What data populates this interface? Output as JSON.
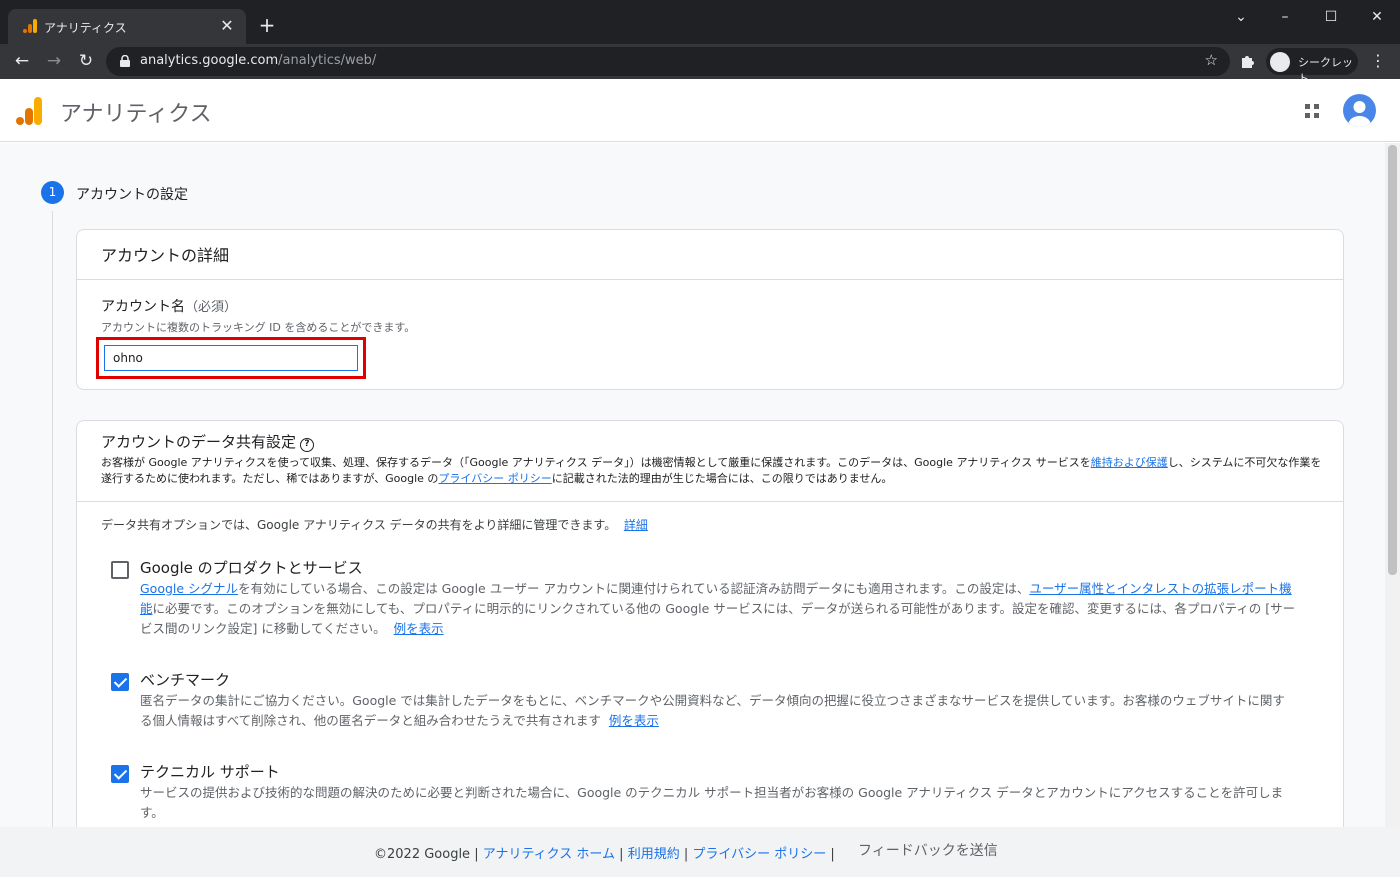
{
  "browser": {
    "tab_title": "アナリティクス",
    "url_host": "analytics.google.com",
    "url_path": "/analytics/web/",
    "incognito_label": "シークレット"
  },
  "header": {
    "app_name": "アナリティクス"
  },
  "step": {
    "number": "1",
    "label": "アカウントの設定"
  },
  "account_details": {
    "title": "アカウントの詳細",
    "field_label": "アカウント名",
    "required": "（必須）",
    "hint": "アカウントに複数のトラッキング ID を含めることができます。",
    "value": "ohno"
  },
  "data_sharing": {
    "title": "アカウントのデータ共有設定",
    "desc_1": "お客様が Google アナリティクスを使って収集、処理、保存するデータ（「Google アナリティクス データ」）は機密情報として厳重に保護されます。このデータは、Google アナリティクス サービスを",
    "desc_link_1": "維持および保護",
    "desc_2": "し、システムに不可欠な作業を遂行するために使われます。ただし、稀ではありますが、Google の",
    "desc_link_2": "プライバシー ポリシー",
    "desc_3": "に記載された法的理由が生じた場合には、この限りではありません。",
    "options_text": "データ共有オプションでは、Google アナリティクス データの共有をより詳細に管理できます。",
    "options_link": "詳細",
    "options": [
      {
        "title": "Google のプロダクトとサービス",
        "checked": false,
        "link_1": "Google シグナル",
        "desc_1": "を有効にしている場合、この設定は Google ユーザー アカウントに関連付けられている認証済み訪問データにも適用されます。この設定は、",
        "link_2": "ユーザー属性とインタレストの拡張レポート機能",
        "desc_2": "に必要です。このオプションを無効にしても、プロパティに明示的にリンクされている他の Google サービスには、データが送られる可能性があります。設定を確認、変更するには、各プロパティの [サービス間のリンク設定] に移動してください。",
        "link_3": "例を表示"
      },
      {
        "title": "ベンチマーク",
        "checked": true,
        "desc_1": "匿名データの集計にご協力ください。Google では集計したデータをもとに、ベンチマークや公開資料など、データ傾向の把握に役立つさまざまなサービスを提供しています。お客様のウェブサイトに関する個人情報はすべて削除され、他の匿名データと組み合わせたうえで共有されます",
        "link_1": "例を表示"
      },
      {
        "title": "テクニカル サポート",
        "checked": true,
        "desc_1": "サービスの提供および技術的な問題の解決のために必要と判断された場合に、Google のテクニカル サポート担当者がお客様の Google アナリティクス データとアカウントにアクセスすることを許可します。"
      }
    ]
  },
  "footer": {
    "copyright": "©2022 Google",
    "link_home": "アナリティクス ホーム",
    "link_terms": "利用規約",
    "link_privacy": "プライバシー ポリシー",
    "feedback": "フィードバックを送信"
  },
  "colors": {
    "accent": "#1a73e8",
    "highlight": "#e00000",
    "logo_orange": "#f9ab00",
    "logo_dark_orange": "#e37400"
  }
}
